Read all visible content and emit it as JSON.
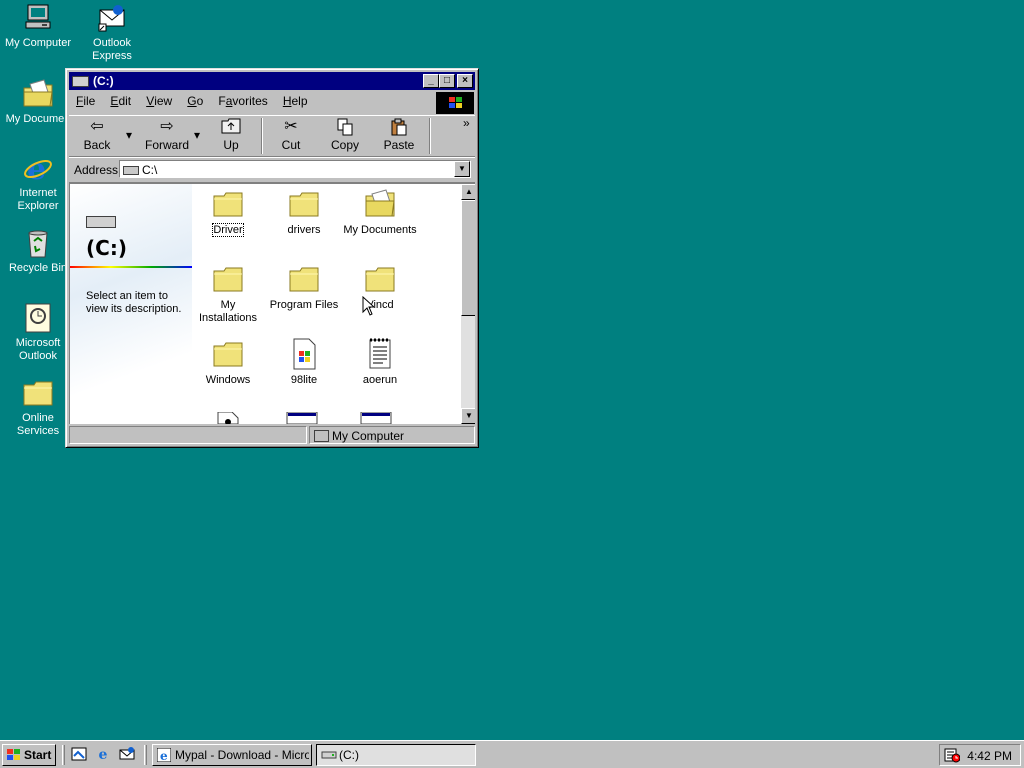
{
  "desktop": {
    "background": "#008080",
    "icons": [
      {
        "label": "My Computer",
        "icon": "computer-icon"
      },
      {
        "label": "Outlook",
        "label2": "Express",
        "icon": "outlook-express-icon"
      },
      {
        "label": "My Documen",
        "icon": "folder-icon"
      },
      {
        "label": "Internet",
        "label2": "Explorer",
        "icon": "internet-explorer-icon"
      },
      {
        "label": "Recycle Bin",
        "icon": "recycle-bin-icon"
      },
      {
        "label": "Microsoft",
        "label2": "Outlook",
        "icon": "outlook-icon"
      },
      {
        "label": "Online",
        "label2": "Services",
        "icon": "folder-icon"
      }
    ]
  },
  "window": {
    "title": "(C:)",
    "title_color": "#000080",
    "controls": {
      "minimize": "_",
      "maximize": "□",
      "close": "×"
    },
    "menu": [
      {
        "key": "F",
        "rest": "ile"
      },
      {
        "key": "E",
        "rest": "dit"
      },
      {
        "key": "V",
        "rest": "iew"
      },
      {
        "key": "G",
        "rest": "o"
      },
      {
        "pre": "F",
        "key": "a",
        "rest": "vorites"
      },
      {
        "key": "H",
        "rest": "elp"
      }
    ],
    "toolbar": {
      "back": "Back",
      "forward": "Forward",
      "up": "Up",
      "cut": "Cut",
      "copy": "Copy",
      "paste": "Paste",
      "more": "»",
      "dropdown": "▾"
    },
    "address": {
      "label": "Address",
      "value": "C:\\"
    },
    "left_pane": {
      "drive_title": "(C:)",
      "description": "Select an item to view its description."
    },
    "items": [
      {
        "label": "Driver",
        "type": "folder",
        "selected": true
      },
      {
        "label": "drivers",
        "type": "folder"
      },
      {
        "label": "My Documents",
        "type": "folder"
      },
      {
        "label": "My",
        "label2": "Installations",
        "type": "folder"
      },
      {
        "label": "Program Files",
        "type": "folder"
      },
      {
        "label": "Vincd",
        "type": "folder"
      },
      {
        "label": "Windows",
        "type": "folder"
      },
      {
        "label": "98lite",
        "type": "file"
      },
      {
        "label": "aoerun",
        "type": "document"
      }
    ],
    "status": {
      "location": "My Computer"
    }
  },
  "taskbar": {
    "start_label": "Start",
    "tasks": [
      {
        "label": "Mypal - Download - Micros...",
        "active": false
      },
      {
        "label": "(C:)",
        "active": true
      }
    ],
    "clock": "4:42 PM"
  }
}
